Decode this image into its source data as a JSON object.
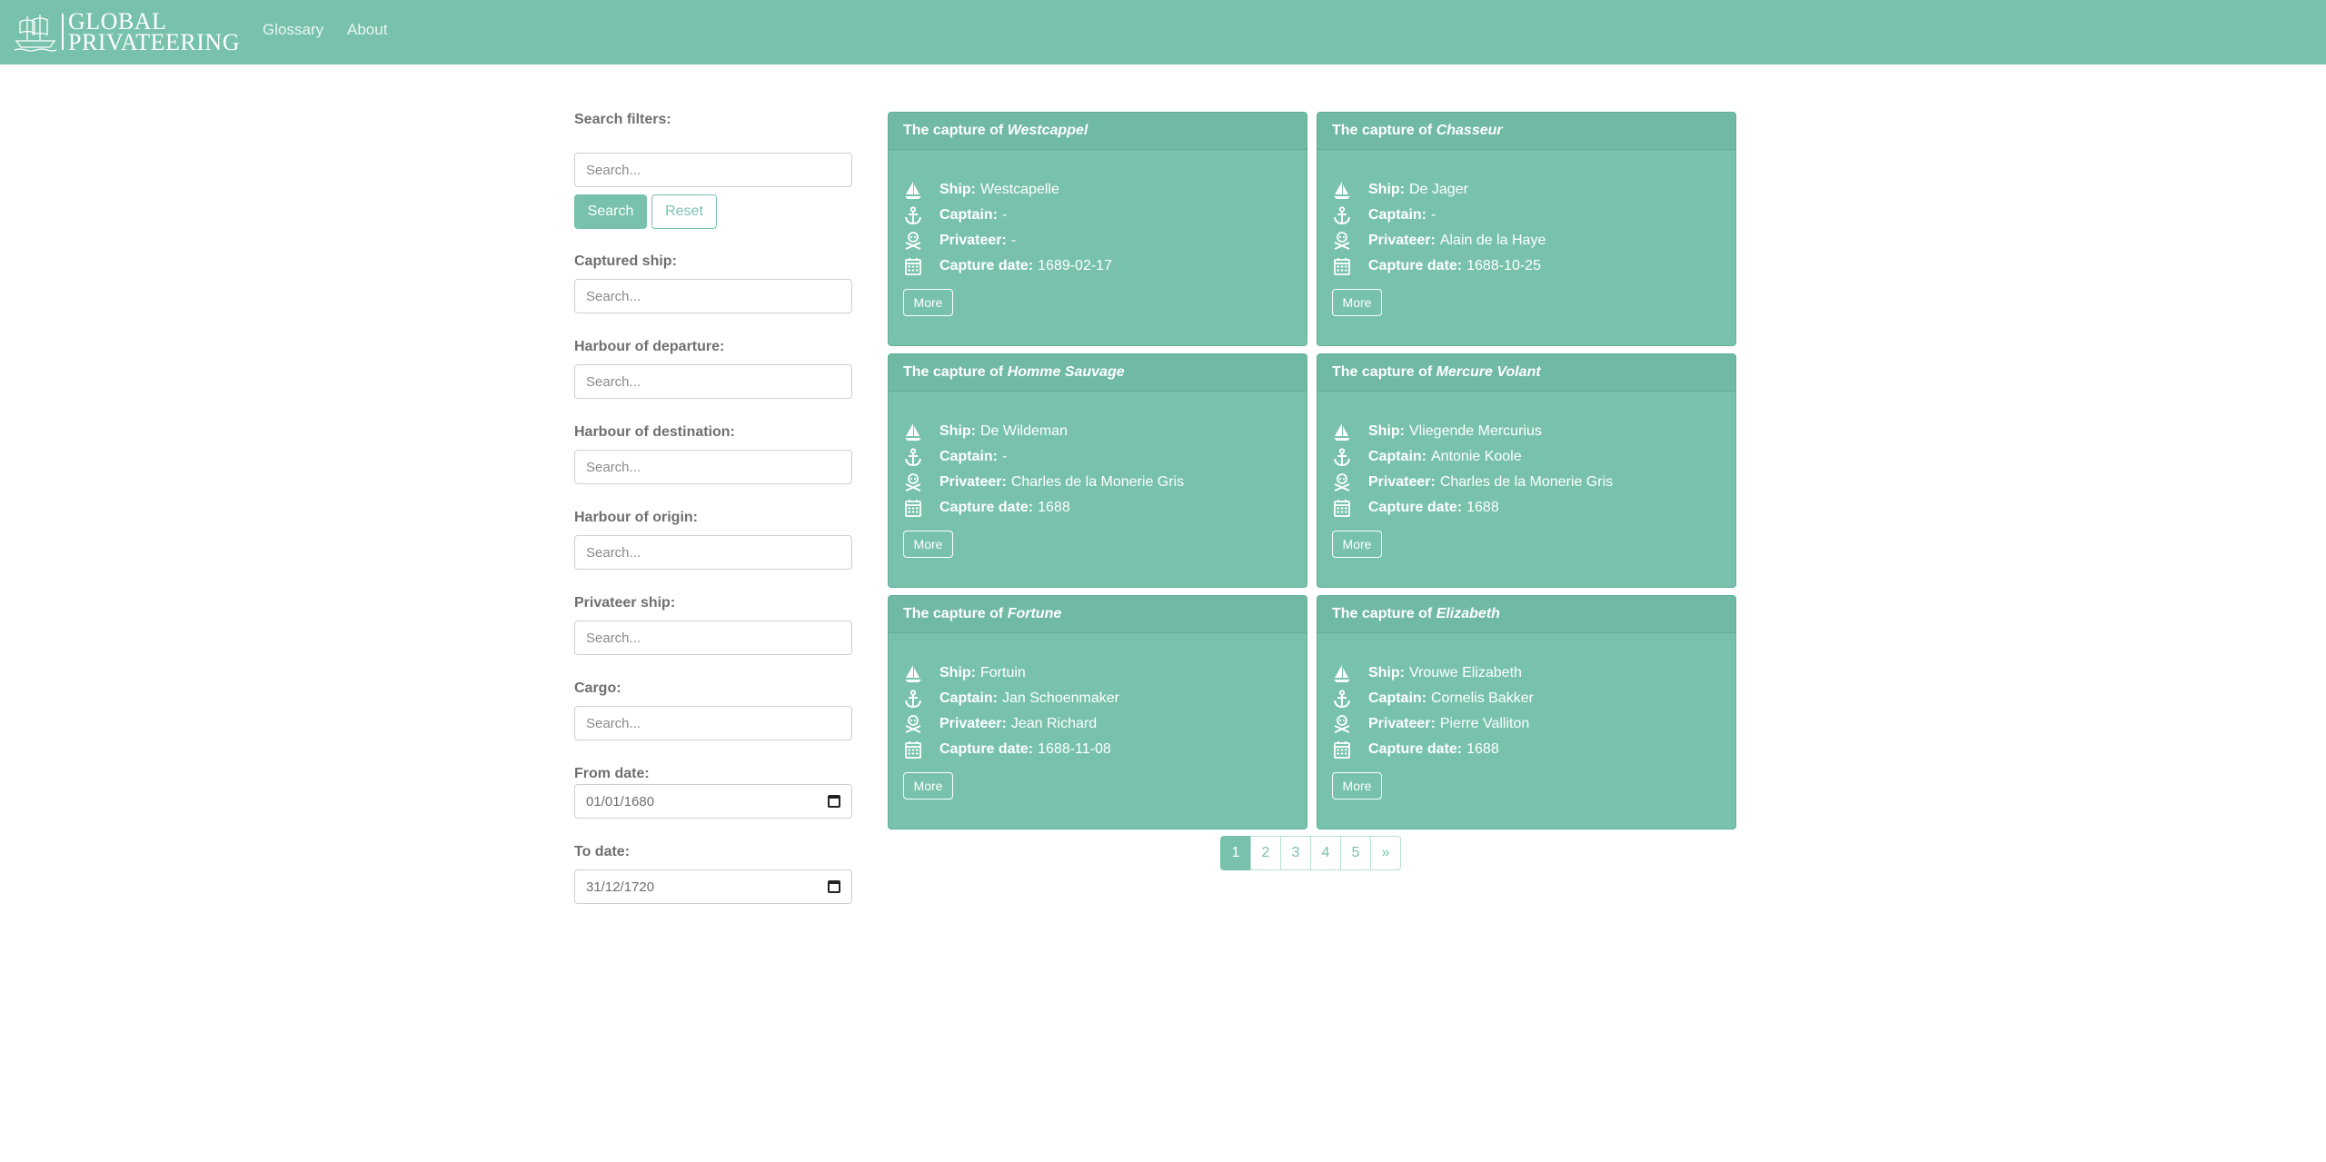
{
  "nav": {
    "logo_line1": "GLOBAL",
    "logo_line2": "PRIVATEERING",
    "links": [
      "Glossary",
      "About"
    ]
  },
  "filters": {
    "heading": "Search filters:",
    "search_placeholder": "Search...",
    "search_button": "Search",
    "reset_button": "Reset",
    "fields": [
      {
        "label": "Captured ship:",
        "placeholder": "Search..."
      },
      {
        "label": "Harbour of departure:",
        "placeholder": "Search..."
      },
      {
        "label": "Harbour of destination:",
        "placeholder": "Search..."
      },
      {
        "label": "Harbour of origin:",
        "placeholder": "Search..."
      },
      {
        "label": "Privateer ship:",
        "placeholder": "Search..."
      },
      {
        "label": "Cargo:",
        "placeholder": "Search..."
      }
    ],
    "from_date": {
      "label": "From date:",
      "value": "01/01/1680"
    },
    "to_date": {
      "label": "To date:",
      "value": "31/12/1720"
    }
  },
  "labels": {
    "title_prefix": "The capture of ",
    "ship": "Ship:",
    "captain": "Captain:",
    "privateer": "Privateer:",
    "capture_date": "Capture date:",
    "more": "More"
  },
  "cards": [
    {
      "name": "Westcappel",
      "ship": "Westcapelle",
      "captain": "-",
      "privateer": "-",
      "capture_date": "1689-02-17"
    },
    {
      "name": "Chasseur",
      "ship": "De Jager",
      "captain": "-",
      "privateer": "Alain de la Haye",
      "capture_date": "1688-10-25"
    },
    {
      "name": "Homme Sauvage",
      "ship": "De Wildeman",
      "captain": "-",
      "privateer": "Charles de la Monerie Gris",
      "capture_date": "1688"
    },
    {
      "name": "Mercure Volant",
      "ship": "Vliegende Mercurius",
      "captain": "Antonie Koole",
      "privateer": "Charles de la Monerie Gris",
      "capture_date": "1688"
    },
    {
      "name": "Fortune",
      "ship": "Fortuin",
      "captain": "Jan Schoenmaker",
      "privateer": "Jean Richard",
      "capture_date": "1688-11-08"
    },
    {
      "name": "Elizabeth",
      "ship": "Vrouwe Elizabeth",
      "captain": "Cornelis Bakker",
      "privateer": "Pierre Valliton",
      "capture_date": "1688"
    }
  ],
  "pagination": {
    "pages": [
      "1",
      "2",
      "3",
      "4",
      "5"
    ],
    "next": "»",
    "active_page": "1"
  },
  "colors": {
    "brand": "#78c2ad",
    "white": "#ffffff"
  }
}
